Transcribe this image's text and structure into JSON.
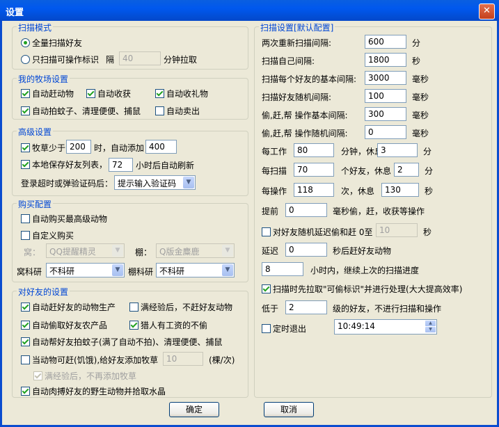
{
  "window": {
    "title": "设置",
    "close": "✕"
  },
  "scan_mode": {
    "title": "扫描模式",
    "opt_all": "全量扫描好友",
    "opt_op": "只扫描可操作标识",
    "interval_label": "隔",
    "interval_value": "40",
    "interval_unit": "分钟拉取"
  },
  "farm": {
    "title": "我的牧场设置",
    "auto_chase": "自动赶动物",
    "auto_harvest": "自动收获",
    "auto_gift": "自动收礼物",
    "auto_swat": "自动拍蚊子、清理便便、捕鼠",
    "auto_sell": "自动卖出"
  },
  "advanced": {
    "title": "高级设置",
    "grass_label": "牧草少于",
    "grass_value": "200",
    "grass_mid": "时，自动添加",
    "grass_add": "400",
    "save_list": "本地保存好友列表，",
    "refresh_hours": "72",
    "refresh_suffix": "小时后自动刷新",
    "timeout_label": "登录超时或弹验证码后：",
    "timeout_value": "提示输入验证码"
  },
  "purchase": {
    "title": "购买配置",
    "buy_best": "自动购买最高级动物",
    "custom": "自定义购买",
    "nest_label": "窝：",
    "nest_value": "QQ提醒精灵",
    "shed_label": "棚：",
    "shed_value": "Q版金麋鹿",
    "nest_research_label": "窝科研",
    "nest_research_value": "不科研",
    "shed_research_label": "棚科研",
    "shed_research_value": "不科研"
  },
  "friends": {
    "title": "对好友的设置",
    "chase_animals": "自动赶好友的动物生产",
    "full_no_chase": "满经验后，不赶好友动物",
    "steal_products": "自动偷取好友农产品",
    "skip_paid": "猎人有工资的不偷",
    "help_swat": "自动帮好友拍蚊子(满了自动不拍)、清理便便、捕鼠",
    "add_grass": "当动物可赶(饥饿),给好友添加牧草",
    "add_grass_value": "10",
    "add_grass_unit": "(棵/次)",
    "full_no_grass": "满经验后，不再添加牧草",
    "meat_crystal": "自动肉搏好友的野生动物并拾取水晶"
  },
  "scan_settings": {
    "title": "扫描设置[默认配置]",
    "rows": [
      {
        "label": "两次重新扫描间隔:",
        "value": "600",
        "unit": "分"
      },
      {
        "label": "扫描自己间隔:",
        "value": "1800",
        "unit": "秒"
      },
      {
        "label": "扫描每个好友的基本间隔:",
        "value": "3000",
        "unit": "毫秒"
      },
      {
        "label": "扫描好友随机间隔:",
        "value": "100",
        "unit": "毫秒"
      },
      {
        "label": "偷,赶,帮 操作基本间隔:",
        "value": "300",
        "unit": "毫秒"
      },
      {
        "label": "偷,赶,帮 操作随机间隔:",
        "value": "0",
        "unit": "毫秒"
      }
    ],
    "work_label": "每工作",
    "work_value": "80",
    "work_mid": "分钟，休息",
    "work_rest": "3",
    "work_unit": "分",
    "scan_label": "每扫描",
    "scan_value": "70",
    "scan_mid": "个好友，休息",
    "scan_rest": "2",
    "scan_unit": "分",
    "op_label": "每操作",
    "op_value": "118",
    "op_mid": "次，休息",
    "op_rest": "130",
    "op_unit": "秒",
    "ahead_label": "提前",
    "ahead_value": "0",
    "ahead_suffix": "毫秒偷，赶，收获等操作",
    "random_delay": "对好友随机延迟偷和赶 0至",
    "random_value": "10",
    "random_unit": "秒",
    "delay_label": "延迟",
    "delay_value": "0",
    "delay_suffix": "秒后赶好友动物",
    "continue_value": "8",
    "continue_suffix": "小时内，继续上次的扫描进度",
    "prefetch": "扫描时先拉取\"可偷标识\"并进行处理(大大提高效率)",
    "below_label": "低于",
    "below_value": "2",
    "below_suffix": "级的好友，不进行扫描和操作",
    "timed_exit": "定时退出",
    "time_value": "10:49:14"
  },
  "buttons": {
    "ok": "确定",
    "cancel": "取消"
  }
}
